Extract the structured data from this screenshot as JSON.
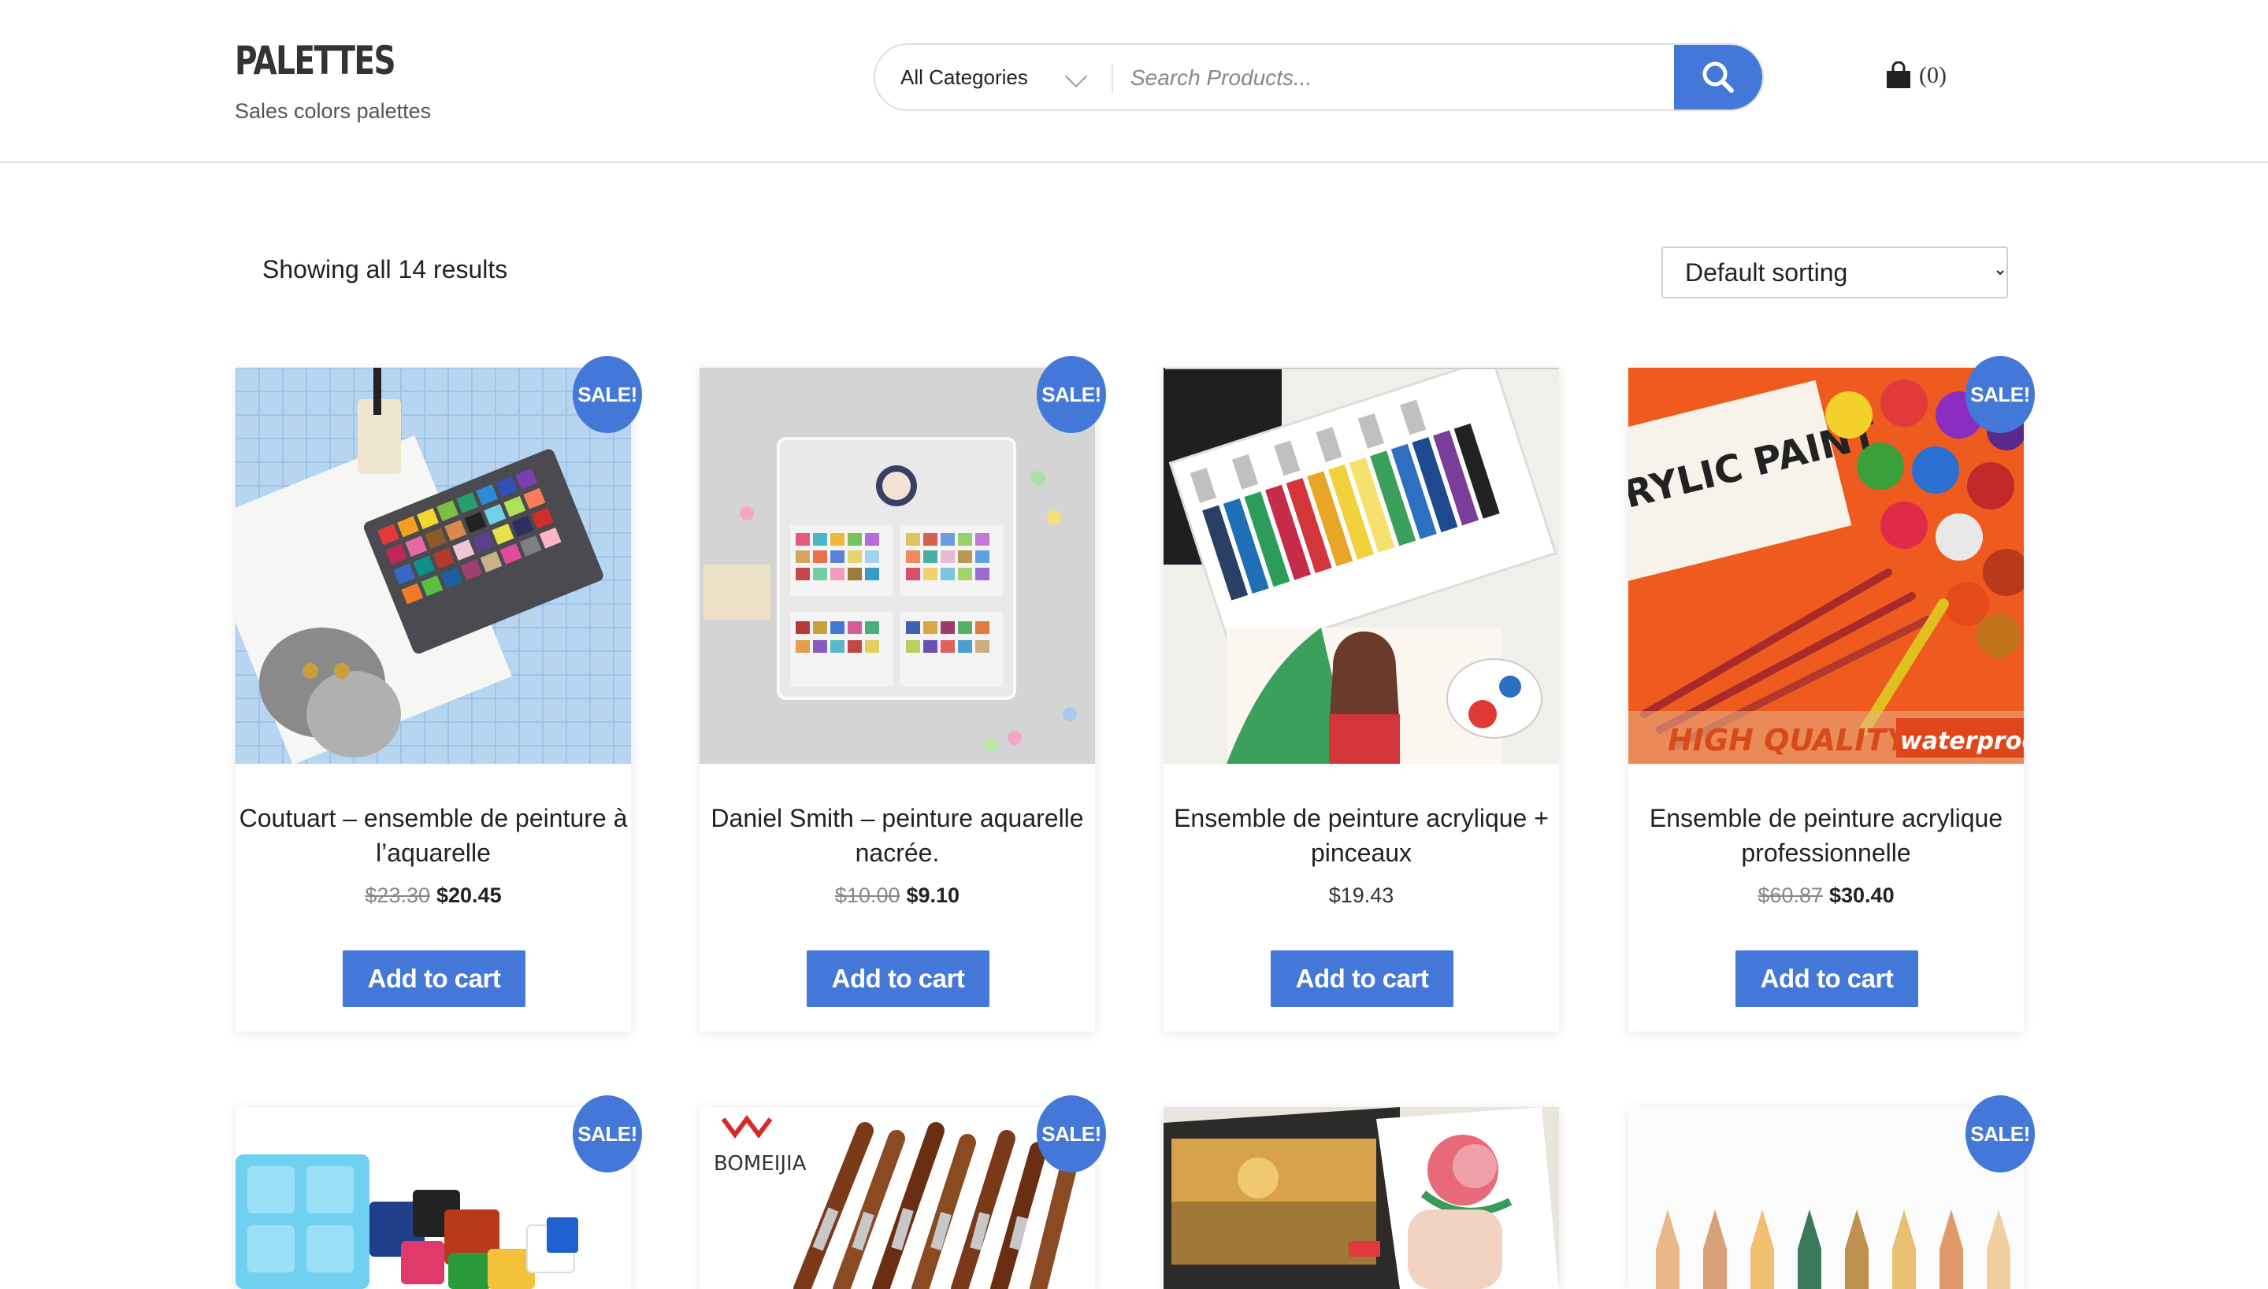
{
  "header": {
    "title": "PALETTES",
    "tagline": "Sales colors palettes",
    "category_select": "All Categories",
    "search_placeholder": "Search Products...",
    "cart_count": "(0)"
  },
  "toolbar": {
    "result_count": "Showing all 14 results",
    "sorting": "Default sorting"
  },
  "sale_badge": "SALE!",
  "add_to_cart_label": "Add to cart",
  "products": [
    {
      "name_line1": "Coutuart – ensemble de peinture à",
      "name_line2": "l’aquarelle",
      "old_price": "$23.30",
      "price": "$20.45",
      "sale": true
    },
    {
      "name_line1": "Daniel Smith – peinture aquarelle",
      "name_line2": "nacrée.",
      "old_price": "$10.00",
      "price": "$9.10",
      "sale": true
    },
    {
      "name_line1": "Ensemble de peinture acrylique +",
      "name_line2": "pinceaux",
      "old_price": "",
      "price": "$19.43",
      "sale": false
    },
    {
      "name_line1": "Ensemble de peinture acrylique",
      "name_line2": "professionnelle",
      "old_price": "$60.87",
      "price": "$30.40",
      "sale": true
    },
    {
      "sale": true
    },
    {
      "sale": true,
      "brand_text": "BOMEIJIA"
    },
    {
      "sale": false
    },
    {
      "sale": true
    }
  ],
  "image_texts": {
    "acrylic_banner": "HIGH QUALITY",
    "acrylic_waterproof": "waterproof",
    "acrylic_box": "RYLIC PAINT"
  }
}
